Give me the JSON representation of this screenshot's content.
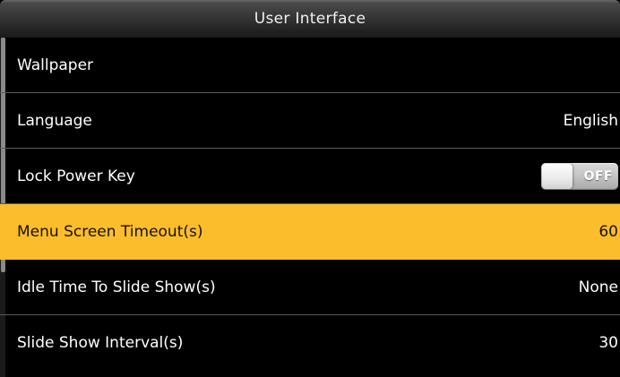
{
  "header": {
    "title": "User Interface"
  },
  "menu": {
    "items": [
      {
        "label": "Wallpaper",
        "value": ""
      },
      {
        "label": "Language",
        "value": "English"
      },
      {
        "label": "Lock Power Key",
        "toggle": "OFF"
      },
      {
        "label": "Menu Screen Timeout(s)",
        "value": "60",
        "selected": true
      },
      {
        "label": "Idle Time To Slide Show(s)",
        "value": "None"
      },
      {
        "label": "Slide Show Interval(s)",
        "value": "30"
      }
    ]
  },
  "colors": {
    "background": "#000000",
    "selected_row": "#fbbd2c",
    "divider": "#5a5a5a",
    "text": "#ffffff"
  }
}
